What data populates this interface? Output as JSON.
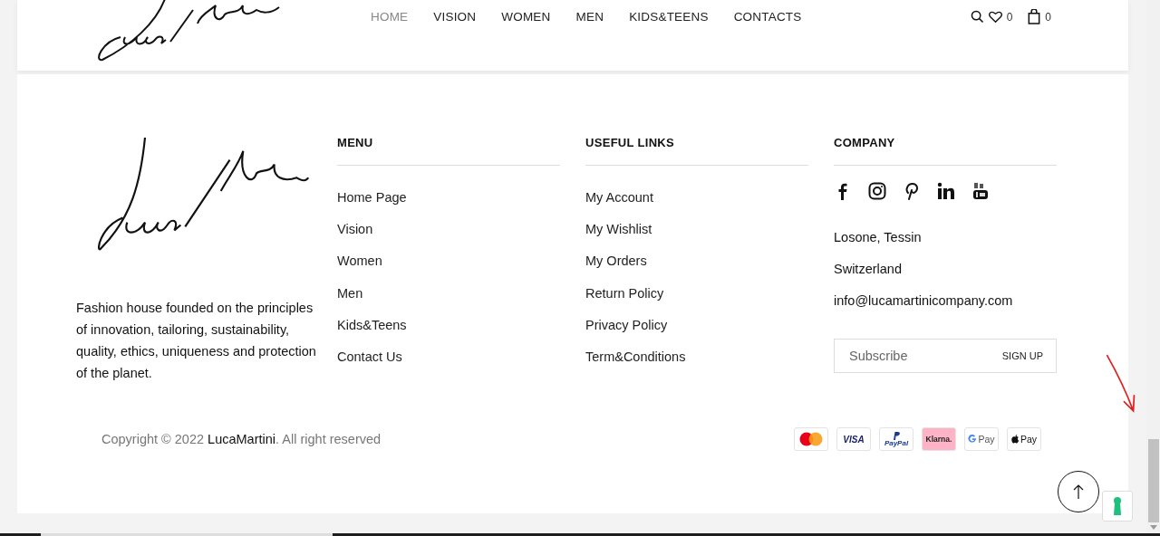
{
  "header": {
    "nav": [
      {
        "label": "HOME",
        "selected": true
      },
      {
        "label": "VISION",
        "selected": false
      },
      {
        "label": "WOMEN",
        "selected": false
      },
      {
        "label": "MEN",
        "selected": false
      },
      {
        "label": "KIDS&TEENS",
        "selected": false
      },
      {
        "label": "CONTACTS",
        "selected": false
      }
    ],
    "wishlist_count": "0",
    "cart_count": "0"
  },
  "footer": {
    "about": "Fashion house founded on the principles of innovation, tailoring, sustainability, quality, ethics, uniqueness and protection of the planet.",
    "columns": [
      {
        "title": "MENU",
        "links": [
          "Home Page",
          "Vision",
          "Women",
          "Men",
          "Kids&Teens",
          "Contact Us"
        ]
      },
      {
        "title": "USEFUL LINKS",
        "links": [
          "My Account",
          "My Wishlist",
          "My Orders",
          "Return Policy",
          "Privacy Policy",
          "Term&Conditions"
        ]
      }
    ],
    "company": {
      "title": "COMPANY",
      "socials": [
        {
          "kind": "facebook"
        },
        {
          "kind": "instagram"
        },
        {
          "kind": "pinterest"
        },
        {
          "kind": "linkedin"
        },
        {
          "kind": "youtube"
        }
      ],
      "address": [
        "Losone, Tessin",
        "Switzerland",
        "info@lucamartinicompany.com"
      ],
      "subscribe": {
        "placeholder": "Subscribe",
        "button": "SIGN UP"
      }
    },
    "copyright": {
      "before": "Copyright © 2022 ",
      "brand": "LucaMartini",
      "after": ". All right reserved"
    },
    "payments": [
      {
        "kind": "mastercard"
      },
      {
        "kind": "visa",
        "label": "VISA"
      },
      {
        "kind": "paypal",
        "label": "PayPal"
      },
      {
        "kind": "klarna",
        "label": "Klarna."
      },
      {
        "kind": "gpay",
        "label": "Pay"
      },
      {
        "kind": "applepay",
        "label": "Pay"
      }
    ]
  }
}
